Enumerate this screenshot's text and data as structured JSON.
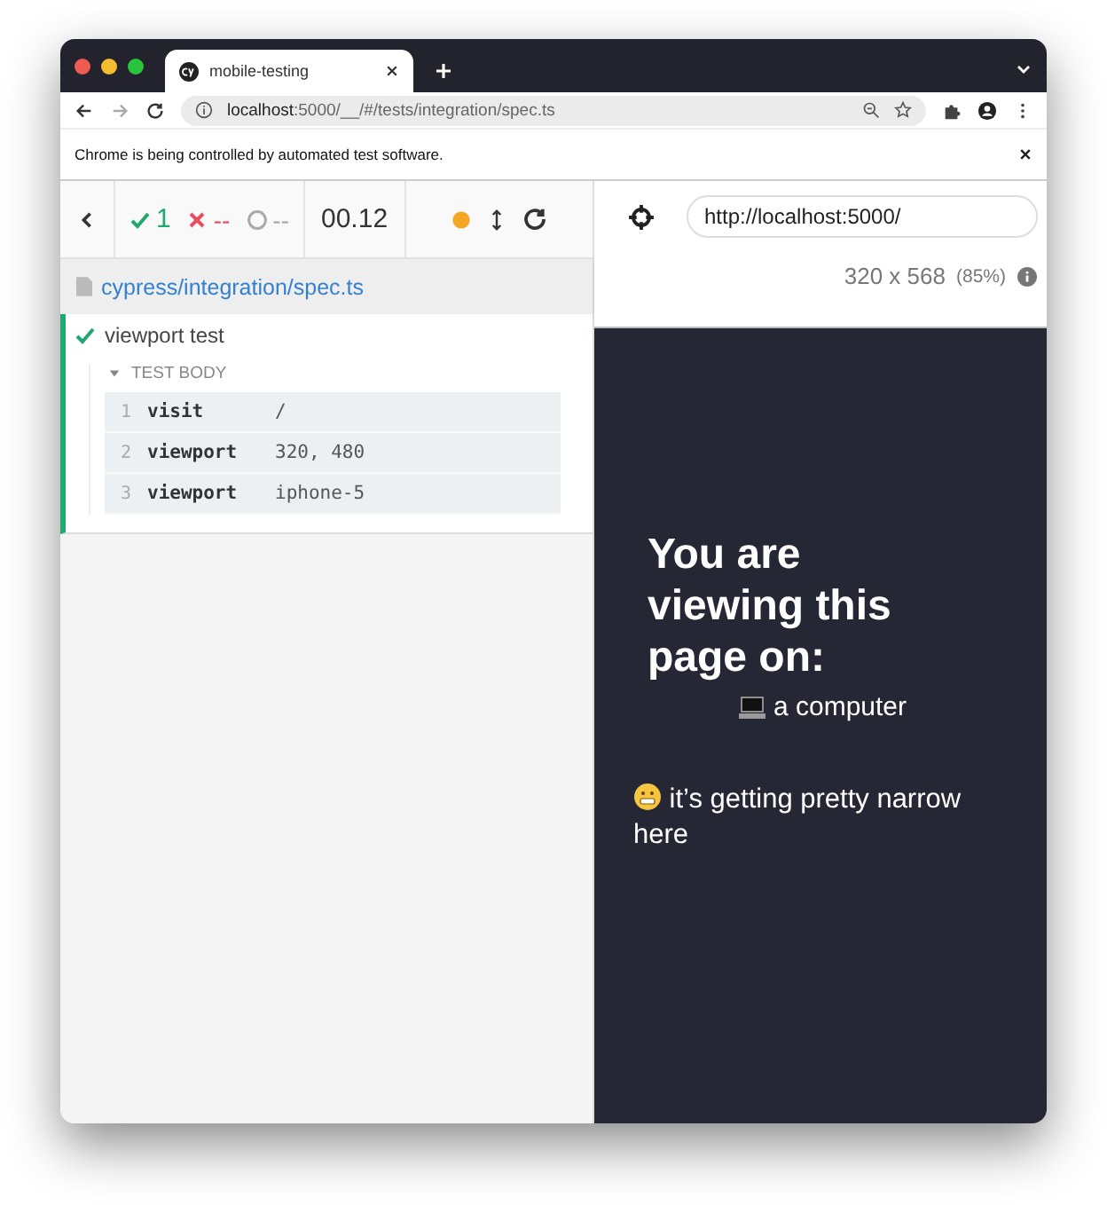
{
  "browser": {
    "tab_title": "mobile-testing",
    "url_host": "localhost",
    "url_rest": ":5000/__/#/tests/integration/spec.ts",
    "infobar": "Chrome is being controlled by automated test software."
  },
  "reporter": {
    "passed": "1",
    "failed": "--",
    "pending": "--",
    "duration": "00.12",
    "spec": "cypress/integration/spec.ts",
    "test": {
      "title": "viewport test",
      "passed": true,
      "section": "TEST BODY",
      "expanded": true,
      "commands": [
        {
          "num": "1",
          "name": "visit",
          "message": "/"
        },
        {
          "num": "2",
          "name": "viewport",
          "message": "320, 480"
        },
        {
          "num": "3",
          "name": "viewport",
          "message": "iphone-5"
        }
      ]
    }
  },
  "aut": {
    "url": "http://localhost:5000/",
    "size": "320 x 568",
    "scale": "(85%)",
    "heading": "You are viewing this page on:",
    "device": "a computer",
    "note": "it’s getting pretty narrow here"
  }
}
